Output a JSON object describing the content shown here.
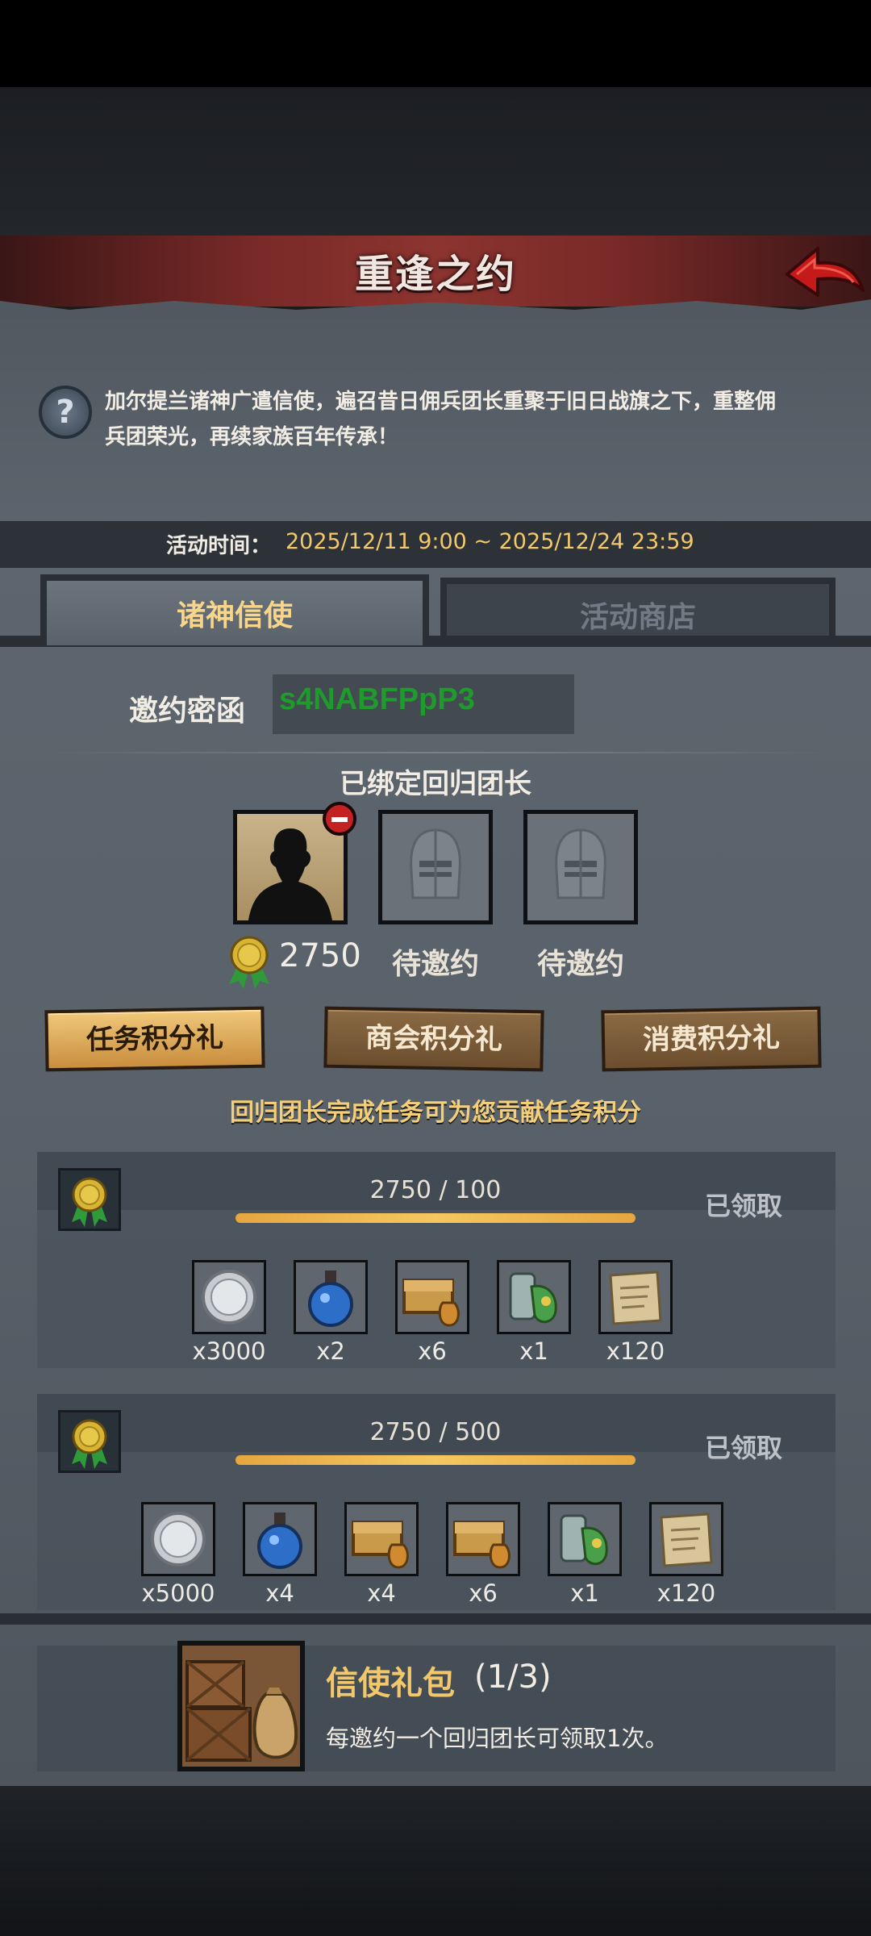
{
  "header": {
    "title": "重逢之约"
  },
  "intro": {
    "text": "加尔提兰诸神广遣信使，遍召昔日佣兵团长重聚于旧日战旗之下，重整佣兵团荣光，再续家族百年传承！"
  },
  "event_time": {
    "label": "活动时间：",
    "value": "2025/12/11 9:00 ~ 2025/12/24 23:59"
  },
  "tabs": [
    {
      "label": "诸神信使",
      "active": true
    },
    {
      "label": "活动商店",
      "active": false
    }
  ],
  "invite": {
    "label": "邀约密函",
    "code": "s4NABFPpP3"
  },
  "bound": {
    "title": "已绑定回归团长",
    "slots": [
      {
        "state": "bound",
        "points": "2750"
      },
      {
        "state": "pending",
        "label": "待邀约"
      },
      {
        "state": "pending",
        "label": "待邀约"
      }
    ]
  },
  "categories": [
    {
      "label": "任务积分礼",
      "active": true
    },
    {
      "label": "商会积分礼",
      "active": false
    },
    {
      "label": "消费积分礼",
      "active": false
    }
  ],
  "hint": "回归团长完成任务可为您贡献任务积分",
  "tiers": [
    {
      "progress": "2750 / 100",
      "status": "已领取",
      "progress_fraction": 1.0,
      "rewards": [
        {
          "icon": "silver-coin-icon",
          "qty": "x3000"
        },
        {
          "icon": "blue-potion-icon",
          "qty": "x2"
        },
        {
          "icon": "treasure-chest-icon",
          "qty": "x6"
        },
        {
          "icon": "elixir-jar-icon",
          "qty": "x1"
        },
        {
          "icon": "parchment-scroll-icon",
          "qty": "x120"
        }
      ]
    },
    {
      "progress": "2750 / 500",
      "status": "已领取",
      "progress_fraction": 1.0,
      "rewards": [
        {
          "icon": "silver-coin-icon",
          "qty": "x5000"
        },
        {
          "icon": "blue-potion-icon",
          "qty": "x4"
        },
        {
          "icon": "treasure-chest-icon",
          "qty": "x4"
        },
        {
          "icon": "treasure-chest-icon",
          "qty": "x6"
        },
        {
          "icon": "elixir-jar-icon",
          "qty": "x1"
        },
        {
          "icon": "parchment-scroll-icon",
          "qty": "x120"
        }
      ]
    }
  ],
  "gift_pack": {
    "title": "信使礼包",
    "count": "(1/3)",
    "desc": "每邀约一个回归团长可领取1次。"
  },
  "colors": {
    "accent_gold": "#f3c86a",
    "invite_code": "#1f9a2c",
    "header_red": "#8c3430",
    "remove_red": "#c42222"
  }
}
